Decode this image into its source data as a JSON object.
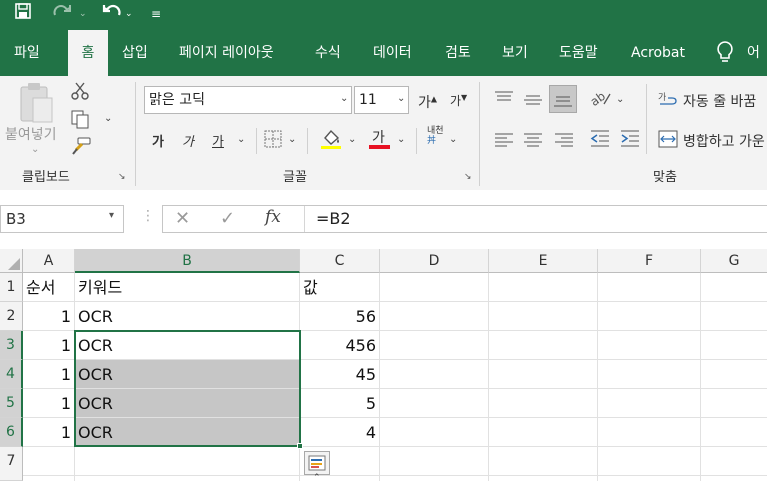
{
  "ribbon_tabs": [
    "파일",
    "홈",
    "삽입",
    "페이지 레이아웃",
    "수식",
    "데이터",
    "검토",
    "보기",
    "도움말",
    "Acrobat",
    "어"
  ],
  "clipboard": {
    "paste_label": "붙여넣기",
    "group_label": "클립보드"
  },
  "font": {
    "name": "맑은 고딕",
    "size": "11",
    "group_label": "글꼴",
    "bold": "가",
    "italic": "가",
    "underline": "가",
    "grow": "가",
    "shrink": "가",
    "color_letter": "가",
    "phonetic": "내천"
  },
  "alignment": {
    "wrap_label": "자동 줄 바꿈",
    "merge_label": "병합하고 가운",
    "group_label": "맞춤"
  },
  "formula_bar": {
    "name_box": "B3",
    "formula": "=B2",
    "fx": "fx"
  },
  "columns": [
    "A",
    "B",
    "C",
    "D",
    "E",
    "F",
    "G"
  ],
  "rows": [
    "1",
    "2",
    "3",
    "4",
    "5",
    "6",
    "7"
  ],
  "cells": {
    "header": {
      "a": "순서",
      "b": "키워드",
      "c": "값"
    },
    "data": [
      {
        "a": "1",
        "b": "OCR",
        "c": "56"
      },
      {
        "a": "1",
        "b": "OCR",
        "c": "456"
      },
      {
        "a": "1",
        "b": "OCR",
        "c": "45"
      },
      {
        "a": "1",
        "b": "OCR",
        "c": "5"
      },
      {
        "a": "1",
        "b": "OCR",
        "c": "4"
      }
    ]
  },
  "colors": {
    "excel_green": "#217346",
    "selection_fill": "#c6c6c6",
    "font_color_bar": "#e81123"
  }
}
